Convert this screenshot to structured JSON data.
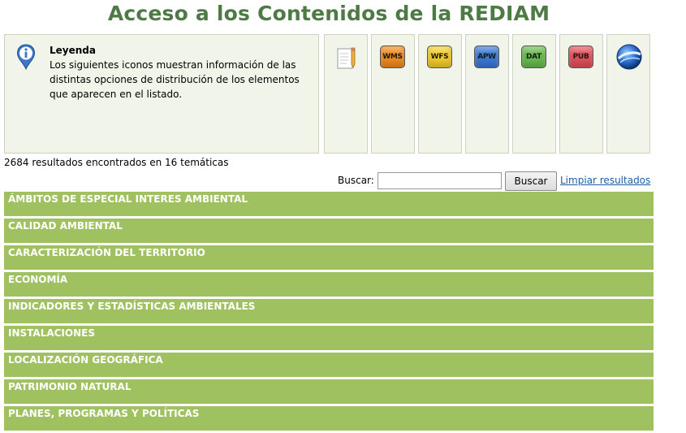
{
  "page": {
    "title": "Acceso a los Contenidos de la REDIAM"
  },
  "legend": {
    "title": "Leyenda",
    "text": "Los siguientes iconos muestran información de las distintas opciones de distribución de los elementos que aparecen en el listado.",
    "icons": [
      {
        "name": "document-icon"
      },
      {
        "label": "WMS",
        "color": "#f08a1c"
      },
      {
        "label": "WFS",
        "color": "#f3cc2a"
      },
      {
        "label": "APW",
        "color": "#3a78d6"
      },
      {
        "label": "DAT",
        "color": "#66bb4e"
      },
      {
        "label": "PUB",
        "color": "#e0505a"
      },
      {
        "name": "google-earth-icon"
      }
    ]
  },
  "results": {
    "summary": "2684 resultados encontrados en 16 temáticas"
  },
  "search": {
    "label": "Buscar:",
    "value": "",
    "button_label": "Buscar",
    "clear_label": "Limpiar resultados"
  },
  "categories": [
    "ÁMBITOS DE ESPECIAL INTERES AMBIENTAL",
    "CALIDAD AMBIENTAL",
    "CARACTERIZACIÓN DEL TERRITORIO",
    "ECONOMÍA",
    "INDICADORES Y ESTADÍSTICAS AMBIENTALES",
    "INSTALACIONES",
    "LOCALIZACIÓN GEOGRÁFICA",
    "PATRIMONIO NATURAL",
    "PLANES, PROGRAMAS Y POLÍTICAS"
  ],
  "colors": {
    "title": "#4e7a45",
    "category_bg": "#9fc160",
    "legend_bg": "#f1f4e8",
    "link": "#1e5ea8"
  }
}
